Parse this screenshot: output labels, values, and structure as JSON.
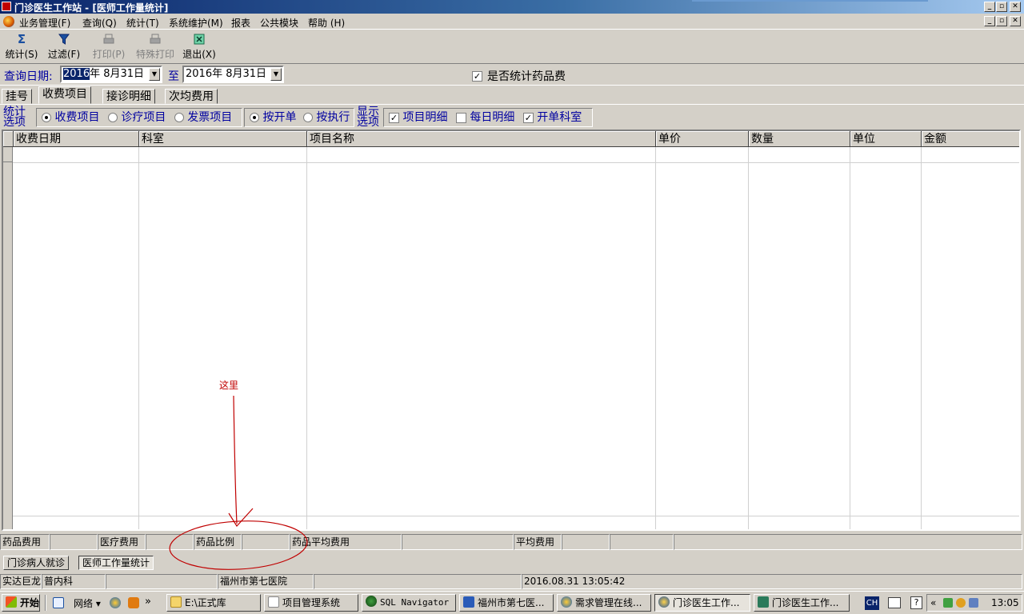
{
  "window": {
    "title": "门诊医生工作站 - [医师工作量统计]",
    "minimize": "_",
    "restore": "▫",
    "close": "✕"
  },
  "menu": {
    "items": [
      "业务管理(F)",
      "查询(Q)",
      "统计(T)",
      "系统维护(M)",
      "报表",
      "公共模块",
      "帮助 (H)"
    ]
  },
  "toolbar": {
    "stat": "统计(S)",
    "filter": "过滤(F)",
    "print": "打印(P)",
    "special_print": "特殊打印",
    "exit": "退出(X)"
  },
  "query": {
    "label": "查询日期:",
    "from_year": "2016",
    "from_rest": "年  8月31日",
    "to_label": "至",
    "to_date": "2016年  8月31日",
    "drug_fee_label": "是否统计药品费",
    "drug_fee_checked": "✓"
  },
  "tabs": [
    "挂号",
    "收费项目",
    "接诊明细",
    "次均费用"
  ],
  "options": {
    "stat_line1": "统计",
    "stat_line2": "选项",
    "stat_items": [
      "收费项目",
      "诊疗项目",
      "发票项目"
    ],
    "mode_items": [
      "按开单",
      "按执行"
    ],
    "display_line1": "显示",
    "display_line2": "选项",
    "display_items": [
      "项目明细",
      "每日明细",
      "开单科室"
    ],
    "check": "✓"
  },
  "grid": {
    "columns": [
      "收费日期",
      "科室",
      "项目名称",
      "单价",
      "数量",
      "单位",
      "金额"
    ]
  },
  "summary": {
    "drug_fee": "药品费用",
    "medical_fee": "医疗费用",
    "drug_ratio": "药品比例",
    "drug_avg_fee": "药品平均费用",
    "avg_fee": "平均费用"
  },
  "window_tabs": [
    "门诊病人就诊",
    "医师工作量统计"
  ],
  "status": {
    "user": "实达巨龙",
    "dept": "普内科",
    "hospital": "福州市第七医院",
    "datetime": "2016.08.31 13:05:42"
  },
  "taskbar": {
    "start": "开始",
    "network": "网络",
    "chevron": "»",
    "tasks": [
      "E:\\正式库",
      "项目管理系统",
      "SQL Navigator",
      "福州市第七医...",
      "需求管理在线...",
      "门诊医生工作...",
      "门诊医生工作..."
    ],
    "ime": "CH",
    "tray_chevron": "«",
    "clock": "13:05"
  },
  "annotation": {
    "text": "这里",
    "color": "#c00000"
  },
  "colors": {
    "title_start": "#0a246a",
    "title_end": "#a6caf0",
    "label_blue": "#0000a0",
    "face": "#d4d0c8"
  }
}
